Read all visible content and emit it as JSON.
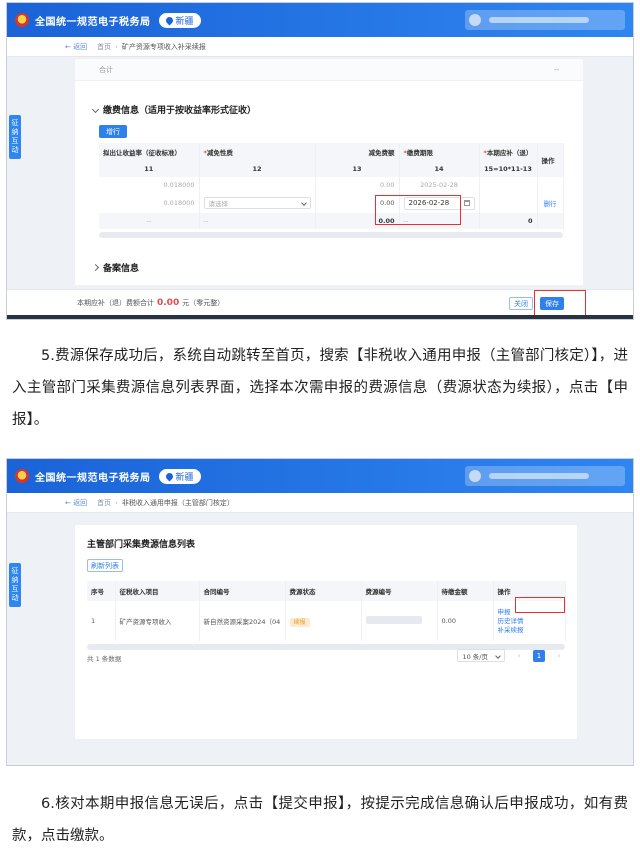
{
  "header": {
    "site_title": "全国统一规范电子税务局",
    "region": "新疆"
  },
  "side_tab": "征纳互动",
  "shot1": {
    "back": "返回",
    "breadcrumb_home": "首页",
    "breadcrumb_current": "矿产资源专项收入补采续报",
    "total_label": "合计",
    "total_value": "--",
    "fee_section_title": "缴费信息（适用于按收益率形式征收）",
    "add_button": "增行",
    "columns": {
      "c11": "拟出让收益率（征收标准）",
      "c12": "减免性质",
      "c13": "减免费额",
      "c14": "缴费期限",
      "c15": "本期应补（退）",
      "ops": "操作"
    },
    "col_nums": {
      "c11": "11",
      "c12": "12",
      "c13": "13",
      "c14": "14",
      "c15": "15=10*11-13"
    },
    "row1": {
      "rate": "0.018000",
      "reduce": "0.00",
      "deadline": "2025-02-28"
    },
    "row2": {
      "rate": "0.018000",
      "select_placeholder": "请选择",
      "reduce": "0.00",
      "deadline": "2026-02-28",
      "op": "删行"
    },
    "sum_row": {
      "c11": "--",
      "c12": "--",
      "c13": "0.00",
      "c14": "--",
      "c15": "0"
    },
    "record_section_title": "备案信息",
    "footer_prefix": "本期应补（退）费额合计",
    "footer_amount": "0.00",
    "footer_suffix": "元（零元整）",
    "close_button": "关闭",
    "save_button": "保存"
  },
  "para5": "5.费源保存成功后，系统自动跳转至首页，搜索【非税收入通用申报（主管部门核定）】，进入主管部门采集费源信息列表界面，选择本次需申报的费源信息（费源状态为续报），点击【申报】。",
  "shot2": {
    "back": "返回",
    "breadcrumb_home": "首页",
    "breadcrumb_current": "非税收入通用申报（主管部门核定）",
    "list_title": "主管部门采集费源信息列表",
    "refresh_button": "刷新列表",
    "columns": [
      "序号",
      "征税收入项目",
      "合同编号",
      "费源状态",
      "费源编号",
      "待缴金额",
      "操作"
    ],
    "row": {
      "index": "1",
      "item": "矿产资源专项收入",
      "contract": "新自然资源采案2024（04",
      "status": "续报",
      "amount": "0.00",
      "ops": [
        "申报",
        "历史详情",
        "补采续报"
      ]
    },
    "total_text": "共 1 条数据",
    "page_size": "10 条/页",
    "page_current": "1",
    "prev": "‹",
    "next": "›"
  },
  "para6": "6.核对本期申报信息无误后，点击【提交申报】，按提示完成信息确认后申报成功，如有费款，点击缴款。"
}
